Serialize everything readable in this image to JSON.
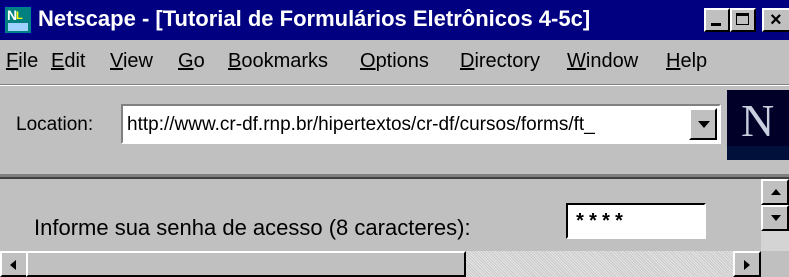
{
  "window": {
    "title": "Netscape - [Tutorial de Formulários Eletrônicos 4-5c]",
    "app_icon": "netscape-app-icon",
    "controls": [
      "minimize",
      "maximize",
      "close"
    ]
  },
  "menubar": {
    "items": [
      "File",
      "Edit",
      "View",
      "Go",
      "Bookmarks",
      "Options",
      "Directory",
      "Window",
      "Help"
    ]
  },
  "location": {
    "label": "Location:",
    "url": "http://www.cr-df.rnp.br/hipertextos/cr-df/cursos/forms/ft_"
  },
  "throbber": {
    "glyph": "N"
  },
  "page": {
    "prompt": "Informe sua senha de acesso (8 caracteres):",
    "password_value": "****"
  },
  "colors": {
    "titlebar": "#000080",
    "chrome": "#c0c0c0"
  }
}
